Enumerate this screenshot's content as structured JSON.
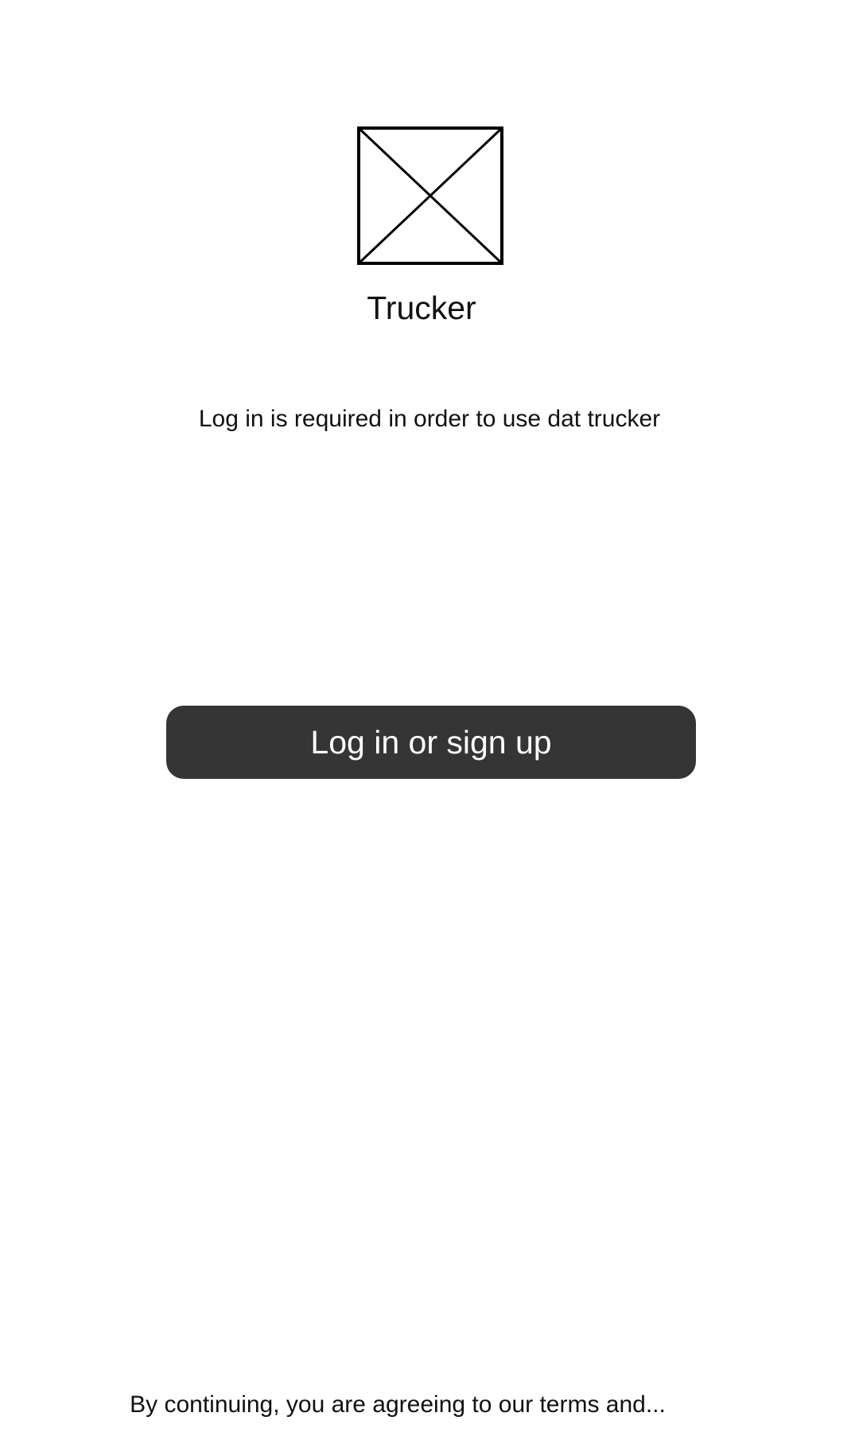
{
  "app": {
    "name": "Trucker",
    "logo_icon": "image-placeholder-icon"
  },
  "main": {
    "subtitle": "Log in is required in order to use dat trucker",
    "login_button_label": "Log in or sign up"
  },
  "footer": {
    "terms_text": "By continuing, you are agreeing to our terms and..."
  },
  "colors": {
    "button_background": "#353535",
    "button_text": "#ffffff",
    "page_background": "#ffffff",
    "text": "#111111"
  }
}
